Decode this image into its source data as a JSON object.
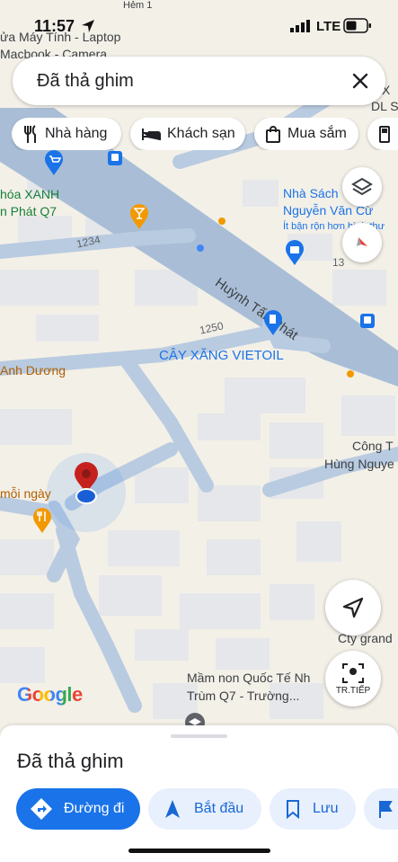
{
  "status": {
    "time": "11:57",
    "network": "LTE"
  },
  "search": {
    "query": "Đã thả ghim"
  },
  "chips": [
    {
      "label": "Nhà hàng",
      "icon": "fork-knife-icon"
    },
    {
      "label": "Khách sạn",
      "icon": "bed-icon"
    },
    {
      "label": "Mua sắm",
      "icon": "shopping-bag-icon"
    }
  ],
  "map_labels": {
    "top_left": "ửa Máy Tính - Laptop",
    "top_left2": "Macbook - Camera",
    "xanh": "hóa XANH",
    "phat": "n Phát Q7",
    "road_1234": "1234",
    "road_1250": "1250",
    "road_13": "13",
    "huynh": "Huỳnh Tấn Phát",
    "nhasach": "Nhà Sách",
    "nguyen": "Nguyễn Văn Cừ",
    "itban": "Ít bận rộn hơn bình thư",
    "cayxang": "CÂY XĂNG VIETOIL",
    "anh_duong": "Anh Dương",
    "cong": "Công T",
    "hung": "Hùng Nguye",
    "moi_ngay": "mỗi ngày",
    "cty": "Cty grand",
    "mamnon": "Mầm non Quốc Tế Nh",
    "trum": "Trùm Q7 - Trường...",
    "dlsc": "DL S",
    "xx": "X",
    "hen": "Hẻm 1"
  },
  "google_logo": "Google",
  "fab": {
    "next_label": "TR.TIẾP"
  },
  "sheet": {
    "title": "Đã thả ghim",
    "directions": "Đường đi",
    "start": "Bắt đầu",
    "save": "Lưu"
  },
  "colors": {
    "accent": "#1a73e8",
    "road": "#a9bed6",
    "pin": "#c5221f"
  }
}
